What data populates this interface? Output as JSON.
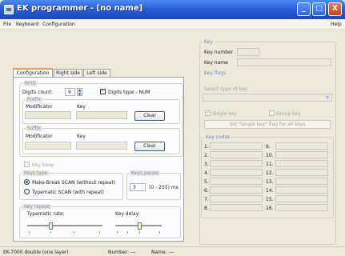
{
  "window": {
    "title": "EK programmer - [no name]"
  },
  "titlebar_buttons": {
    "minimize": "_",
    "maximize": "□",
    "close": "X"
  },
  "menu": {
    "file": "File",
    "keyboard": "Keyboard",
    "configuration": "Configuration",
    "help": "Help"
  },
  "tabs": {
    "configuration": "Configuration",
    "right_side": "Right side",
    "left_side": "Left side"
  },
  "rfid": {
    "legend": "RFID",
    "digits_count_label": "Digits count:",
    "digits_count_value": "9",
    "digits_type_label": "Digits type - NUM",
    "digits_type_checked": true
  },
  "prefix": {
    "legend": "Prefix",
    "modificator_label": "Modificator",
    "key_label": "Key",
    "clear_label": "Clear"
  },
  "suffix": {
    "legend": "Suffix",
    "modificator_label": "Modificator",
    "key_label": "Key",
    "clear_label": "Clear"
  },
  "key_beep_label": "Key beep",
  "keys_type": {
    "legend": "Keys type",
    "option_make_break": "Make-Break SCAN (without repeat)",
    "option_typematic": "Typematic SCAN (with repeat)",
    "selected": "make_break"
  },
  "keys_pause": {
    "legend": "Keys pause",
    "value": "3",
    "range": "(0 - 255) ms"
  },
  "key_repeat": {
    "legend": "Key repeat",
    "typematic_rate_label": "Typematic rate:",
    "key_delay_label": "Key delay:"
  },
  "key": {
    "legend": "Key",
    "key_number_label": "Key number",
    "key_name_label": "Key name",
    "key_flags_label": "Key flags",
    "select_type_label": "Select type of key",
    "single_key_label": "Single key",
    "group_key_label": "Group key",
    "set_flag_button": "Set \"single key\" flag for all keys"
  },
  "key_codes": {
    "legend": "Key codes",
    "left": [
      "1.",
      "2.",
      "3.",
      "4.",
      "5.",
      "6.",
      "7.",
      "8."
    ],
    "right": [
      "9.",
      "10.",
      "11.",
      "12.",
      "13.",
      "14.",
      "15.",
      "16."
    ]
  },
  "status": {
    "device": "EK-7000 double (one layer)",
    "number": "Number: ---",
    "name": "Name: ---"
  }
}
